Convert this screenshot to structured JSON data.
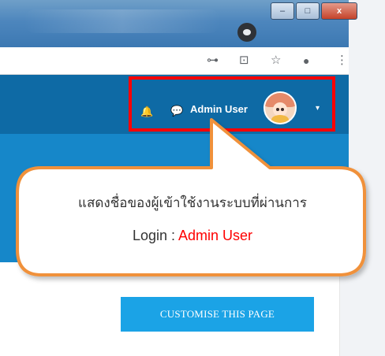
{
  "window": {
    "minimize_label": "–",
    "maximize_label": "□",
    "close_label": "x"
  },
  "toolbar": {
    "icons": [
      "key-icon",
      "translate-icon",
      "star-icon",
      "profile-icon",
      "menu-icon"
    ],
    "key_glyph": "⊶",
    "translate_glyph": "⊡",
    "star_glyph": "☆",
    "profile_glyph": "●",
    "menu_glyph": "⋮"
  },
  "navbar": {
    "bell_glyph": "🔔",
    "chat_glyph": "💬",
    "user_name": "Admin User",
    "caret_glyph": "▾",
    "background": "#0e6aa5"
  },
  "page": {
    "customise_button_label": "CUSTOMISE THIS PAGE",
    "header_color": "#1687c9"
  },
  "callout": {
    "line1": "แสดงชื่อของผู้เข้าใช้งานระบบที่ผ่านการ",
    "line2_prefix": "Login : ",
    "line2_highlight": "Admin User",
    "border_color": "#f0913a",
    "highlight_color": "#ff0000"
  }
}
